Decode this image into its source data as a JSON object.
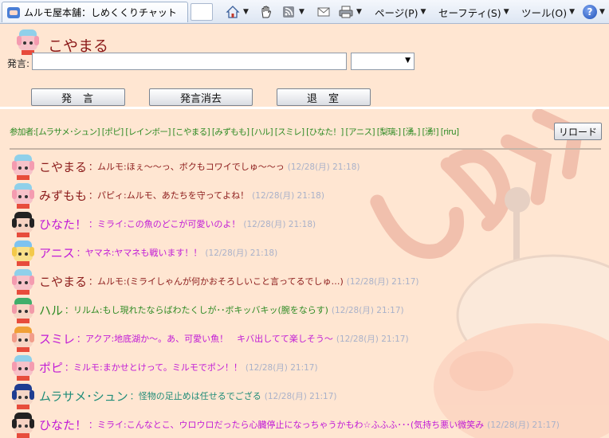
{
  "browser": {
    "tab_title": "ムルモ屋本舗：しめくくりチャット",
    "menus": {
      "page": "ページ(P)",
      "safety": "セーフティ(S)",
      "tools": "ツール(O)"
    }
  },
  "chat": {
    "current_user": "こやまる",
    "say_label": "発言:",
    "say_value": "",
    "color_selected": "",
    "buttons": {
      "say": "発言",
      "clear": "発言消去",
      "leave": "退室",
      "reload": "リロード"
    },
    "participants": "参加者:[ムラサメ･シュン] [ポピ] [レインボー] [こやまる] [みずもも] [ハル] [スミレ] [ひなた！] [アニス] [梨璃:] [湧｡] [湧!] [riru]",
    "messages": [
      {
        "name": "こやまる",
        "text": "：ムルモ:ほぇ～～っ、ボクもコワイでしゅ～～っ",
        "time": "(12/28(月) 21:18)",
        "color": "#8b1a1a",
        "avatar": "pink"
      },
      {
        "name": "みずもも",
        "text": "：パピィ:ムルモ、あたちを守ってよね！",
        "time": "(12/28(月) 21:18)",
        "color": "#8b1a1a",
        "avatar": "pink"
      },
      {
        "name": "ひなた！",
        "text": "：ミライ:この魚のどこが可愛いのよ！",
        "time": "(12/28(月) 21:18)",
        "color": "#c11bd6",
        "avatar": "dark"
      },
      {
        "name": "アニス",
        "text": "：ヤマネ:ヤマネも戦います！！",
        "time": "(12/28(月) 21:18)",
        "color": "#c11bd6",
        "avatar": "yellow"
      },
      {
        "name": "こやまる",
        "text": "：ムルモ:(ミライしゃんが何かおそろしいこと言ってるでしゅ…)",
        "time": "(12/28(月) 21:17)",
        "color": "#8b1a1a",
        "avatar": "pink"
      },
      {
        "name": "ハル",
        "text": "：リルム:もし現れたならばわたくしが･･ボキッバキッ(腕をならす)",
        "time": "(12/28(月) 21:17)",
        "color": "#2e8b24",
        "avatar": "green"
      },
      {
        "name": "スミレ",
        "text": "：アクア:地底湖か～。あ、可愛い魚！　キバ出してて楽しそう～",
        "time": "(12/28(月) 21:17)",
        "color": "#c11bd6",
        "avatar": "orange"
      },
      {
        "name": "ポピ",
        "text": "：ミルモ:まかせとけって。ミルモでポン！！",
        "time": "(12/28(月) 21:17)",
        "color": "#c11bd6",
        "avatar": "pink"
      },
      {
        "name": "ムラサメ･シュン",
        "text": "：怪物の足止めは任せるでござる",
        "time": "(12/28(月) 21:17)",
        "color": "#1f8c78",
        "avatar": "blue"
      },
      {
        "name": "ひなた！",
        "text": "：ミライ:こんなとこ、ウロウロだったら心臓停止になっちゃうかもわ☆ふふふ･･･(気持ち悪い微笑み",
        "time": "(12/28(月) 21:17)",
        "color": "#c11bd6",
        "avatar": "dark"
      }
    ]
  }
}
